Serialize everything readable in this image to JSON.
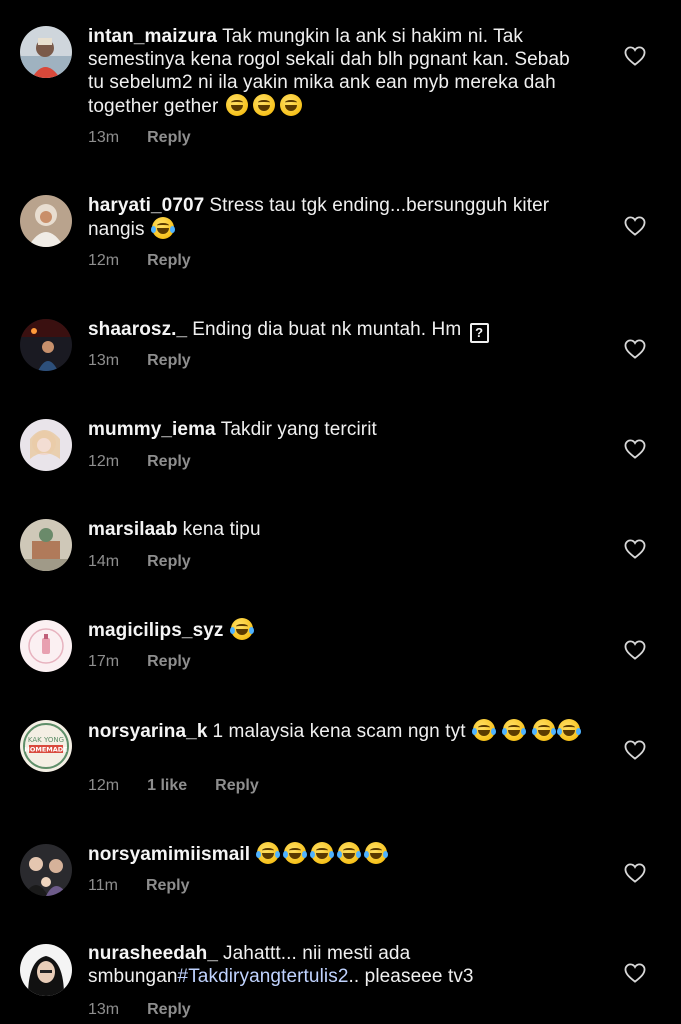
{
  "reply_label": "Reply",
  "comments": [
    {
      "username": "intan_maizura",
      "text": "Tak mungkin la ank si hakim ni. Tak semestinya kena rogol sekali dah blh pgnant kan. Sebab tu sebelum2 ni ila yakin mika ank ean myb mereka dah together gether",
      "emojis": [
        "grin-sweat",
        "grin-sweat",
        "grin-sweat"
      ],
      "time": "13m",
      "likes": ""
    },
    {
      "username": "haryati_0707",
      "text": "Stress tau tgk ending...bersungguh kiter nangis",
      "emojis": [
        "tears-of-joy"
      ],
      "time": "12m",
      "likes": ""
    },
    {
      "username": "shaarosz._",
      "text": "Ending dia buat nk muntah. Hm",
      "box_glyph": "?",
      "time": "13m",
      "likes": ""
    },
    {
      "username": "mummy_iema",
      "text": "Takdir yang tercirit",
      "time": "12m",
      "likes": ""
    },
    {
      "username": "marsilaab",
      "text": "kena tipu",
      "time": "14m",
      "likes": ""
    },
    {
      "username": "magicilips_syz",
      "text": "",
      "emojis": [
        "tears-of-joy"
      ],
      "time": "17m",
      "likes": ""
    },
    {
      "username": "norsyarina_k",
      "text": "1 malaysia kena scam ngn tyt",
      "emojis": [
        "tears-of-joy",
        "tears-of-joy",
        "tears-of-joy",
        "tears-of-joy"
      ],
      "time": "12m",
      "likes": "1 like"
    },
    {
      "username": "norsyamimiismail",
      "text": "",
      "emojis": [
        "tears-of-joy",
        "tears-of-joy",
        "tears-of-joy",
        "tears-of-joy",
        "tears-of-joy"
      ],
      "time": "11m",
      "likes": ""
    },
    {
      "username": "nurasheedah_",
      "text": "Jahattt... nii mesti ada smbungan",
      "hashtag": "#Takdiryangtertulis2",
      "text_after": ".. pleaseee tv3",
      "time": "13m",
      "likes": ""
    }
  ],
  "avatar_text": {
    "kak_yong_line1": "KAK YONG",
    "kak_yong_line2": "HOMEMADE"
  },
  "colors": {
    "background": "#000000",
    "meta_gray": "#8e8e8e",
    "hashtag": "#c0d3ff"
  },
  "icons": {
    "like": "heart-outline-icon"
  }
}
